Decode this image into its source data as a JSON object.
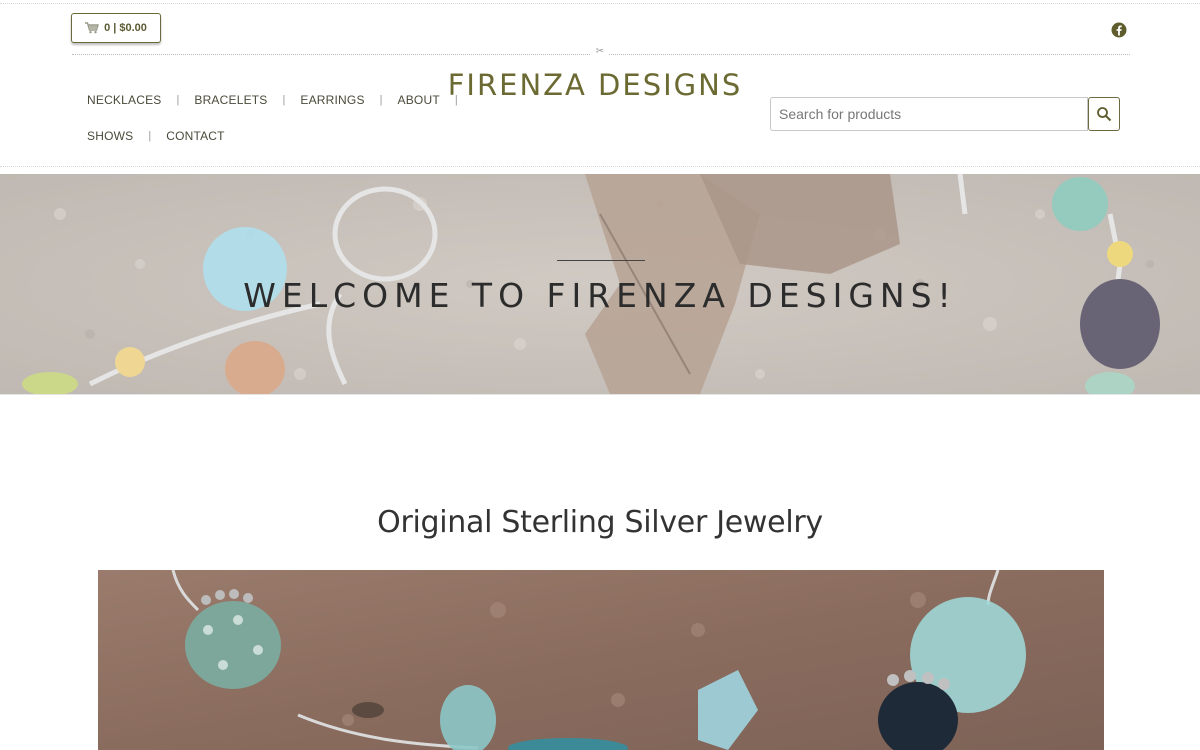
{
  "colors": {
    "brand_olive": "#6b6a32",
    "text_dark": "#333333",
    "border_olive": "#6b6a3e"
  },
  "cart": {
    "icon": "cart-icon",
    "label": "0 | $0.00"
  },
  "social": {
    "facebook_icon": "facebook-icon"
  },
  "nav": {
    "row1": [
      {
        "label": "NECKLACES"
      },
      {
        "label": "BRACELETS"
      },
      {
        "label": "EARRINGS"
      },
      {
        "label": "ABOUT"
      }
    ],
    "row2": [
      {
        "label": "SHOWS"
      },
      {
        "label": "CONTACT"
      }
    ]
  },
  "site": {
    "title": "FIRENZA DESIGNS"
  },
  "search": {
    "placeholder": "Search for products",
    "value": "",
    "icon": "search-icon"
  },
  "hero": {
    "title": "WELCOME TO FIRENZA DESIGNS!"
  },
  "main": {
    "heading": "Original Sterling Silver Jewelry"
  }
}
